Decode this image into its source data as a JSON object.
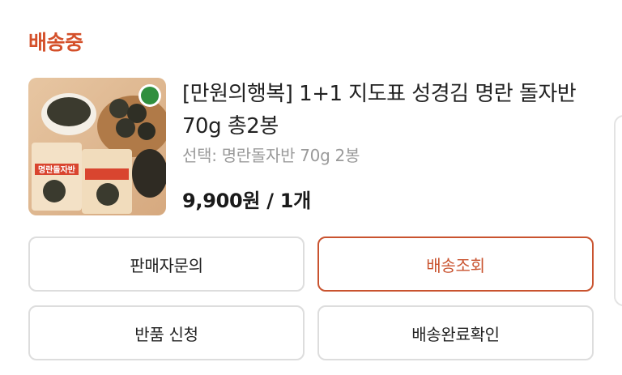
{
  "order": {
    "status": "배송중",
    "status_color": "#d4502a",
    "product": {
      "title": "[만원의행복] 1+1 지도표 성경김 명란 돌자반 70g 총2봉",
      "option": "선택: 명란돌자반 70g 2봉",
      "price": "9,900원 / 1개",
      "package_text": "명란돌자반"
    }
  },
  "actions": {
    "seller_inquiry": "판매자문의",
    "track_delivery": "배송조회",
    "return_request": "반품 신청",
    "confirm_delivery": "배송완료확인"
  },
  "accent_color": "#c9532f"
}
